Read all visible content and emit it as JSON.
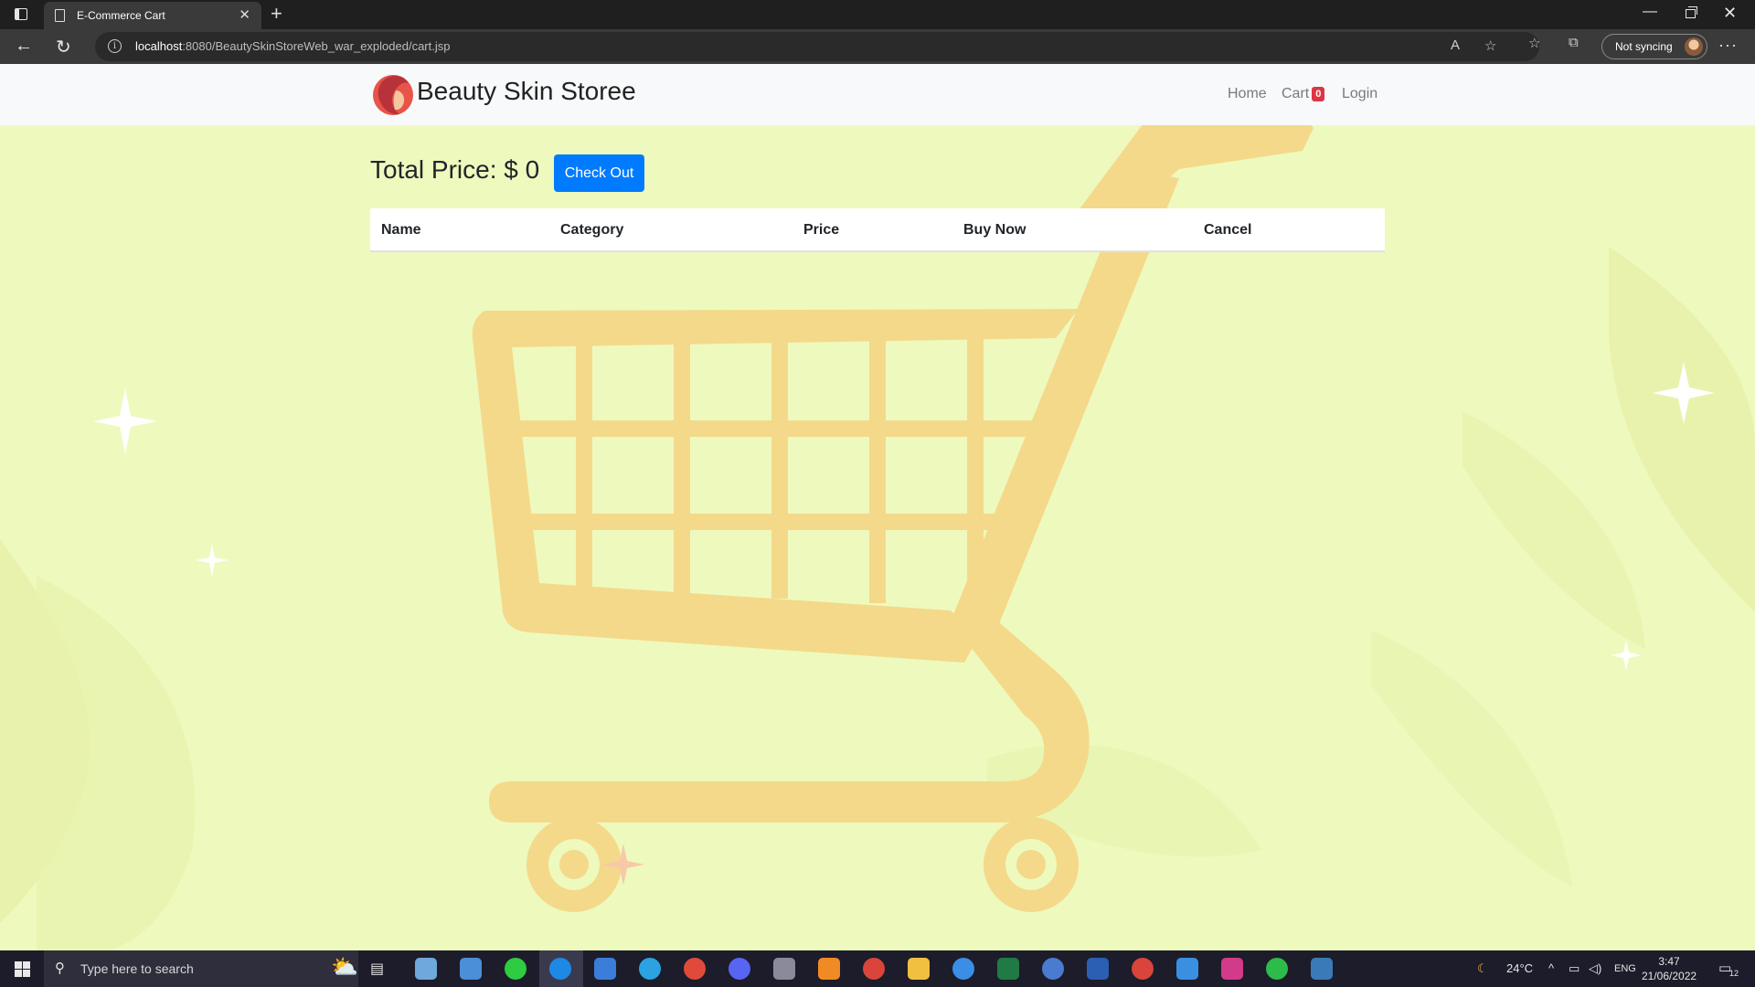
{
  "browser": {
    "tab_title": "E-Commerce Cart",
    "url_host": "localhost",
    "url_rest": ":8080/BeautySkinStoreWeb_war_exploded/cart.jsp",
    "sync_label": "Not syncing",
    "new_tab": "+",
    "close_tab": "✕"
  },
  "site": {
    "brand": "Beauty Skin Storee",
    "nav": {
      "home": "Home",
      "cart": "Cart",
      "cart_count": "0",
      "login": "Login"
    }
  },
  "cart": {
    "total_label": "Total Price: $ 0",
    "checkout_label": "Check Out",
    "columns": [
      "Name",
      "Category",
      "Price",
      "Buy Now",
      "Cancel"
    ]
  },
  "taskbar": {
    "search_placeholder": "Type here to search",
    "temperature": "24°C",
    "language": "ENG",
    "time": "3:47",
    "date": "21/06/2022",
    "notification_count": "12"
  },
  "colors": {
    "page_bg": "#eef9bd",
    "cart_art": "#f4d98a",
    "accent": "#007bff",
    "badge": "#dc3545"
  }
}
